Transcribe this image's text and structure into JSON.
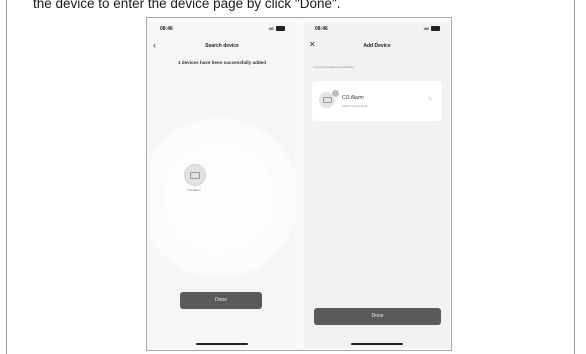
{
  "instruction": "the device to enter the device page by click \"Done\".",
  "left_screen": {
    "status": {
      "time": "08:46",
      "signal": "4G"
    },
    "nav": {
      "back_icon": "chevron-left-icon",
      "title": "Search device"
    },
    "message": "1 devices have been successfully added",
    "device_label": "CO Alarm",
    "done_label": "Done"
  },
  "right_screen": {
    "status": {
      "time": "08:46",
      "signal": "4G"
    },
    "nav": {
      "close_icon": "close-icon",
      "title": "Add Device"
    },
    "added_caption": "1 device(s) added successfully",
    "device": {
      "name": "CO Alarm",
      "status": "Added successfully"
    },
    "done_label": "Done"
  },
  "colors": {
    "button": "#5a5a5a",
    "background": "#f4f4f4",
    "card": "#ffffff"
  }
}
